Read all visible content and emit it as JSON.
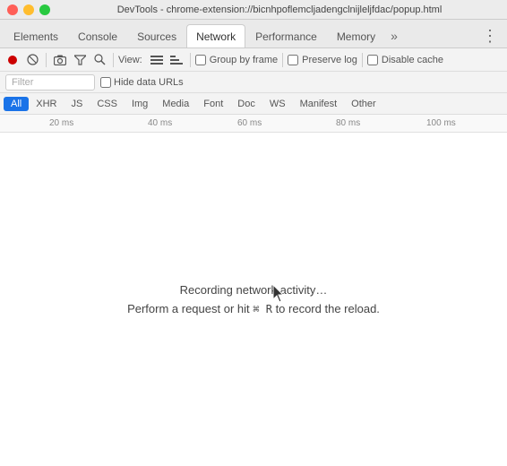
{
  "titlebar": {
    "title": "DevTools - chrome-extension://bicnhpoflemcljadengclnijleljfdac/popup.html"
  },
  "tabs": [
    {
      "id": "elements",
      "label": "Elements",
      "active": false
    },
    {
      "id": "console",
      "label": "Console",
      "active": false
    },
    {
      "id": "sources",
      "label": "Sources",
      "active": false
    },
    {
      "id": "network",
      "label": "Network",
      "active": true
    },
    {
      "id": "performance",
      "label": "Performance",
      "active": false
    },
    {
      "id": "memory",
      "label": "Memory",
      "active": false
    }
  ],
  "toolbar": {
    "view_label": "View:",
    "group_by_frame_label": "Group by frame",
    "preserve_log_label": "Preserve log",
    "disable_cache_label": "Disable cache"
  },
  "filter": {
    "placeholder": "Filter",
    "hide_data_urls_label": "Hide data URLs"
  },
  "type_tabs": [
    {
      "id": "all",
      "label": "All",
      "active": true
    },
    {
      "id": "xhr",
      "label": "XHR",
      "active": false
    },
    {
      "id": "js",
      "label": "JS",
      "active": false
    },
    {
      "id": "css",
      "label": "CSS",
      "active": false
    },
    {
      "id": "img",
      "label": "Img",
      "active": false
    },
    {
      "id": "media",
      "label": "Media",
      "active": false
    },
    {
      "id": "font",
      "label": "Font",
      "active": false
    },
    {
      "id": "doc",
      "label": "Doc",
      "active": false
    },
    {
      "id": "ws",
      "label": "WS",
      "active": false
    },
    {
      "id": "manifest",
      "label": "Manifest",
      "active": false
    },
    {
      "id": "other",
      "label": "Other",
      "active": false
    }
  ],
  "timeline": {
    "ticks": [
      {
        "label": "20 ms",
        "position": 55
      },
      {
        "label": "40 ms",
        "position": 165
      },
      {
        "label": "60 ms",
        "position": 275
      },
      {
        "label": "80 ms",
        "position": 385
      },
      {
        "label": "100 ms",
        "position": 490
      }
    ]
  },
  "main": {
    "recording_text": "Recording network activity…",
    "hint_text": "Perform a request or hit",
    "keyboard_shortcut": "⌘ R",
    "hint_text_suffix": "to record the reload."
  }
}
